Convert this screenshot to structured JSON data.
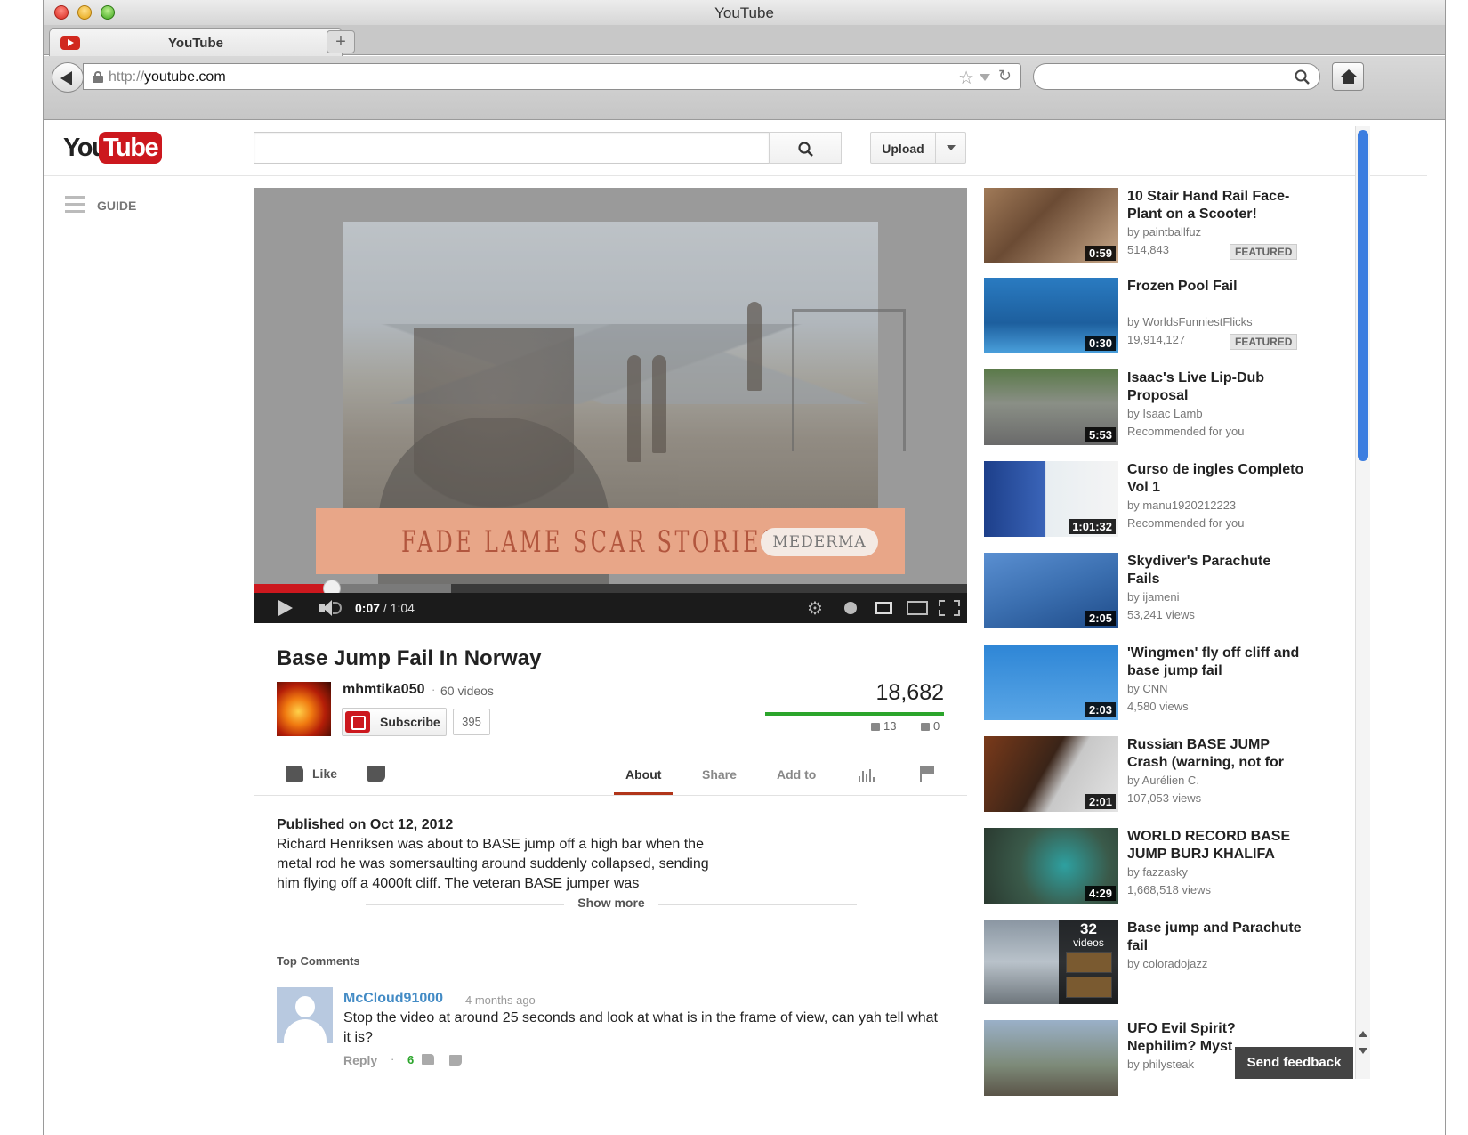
{
  "browser": {
    "window_title": "YouTube",
    "tab_title": "YouTube",
    "new_tab": "+",
    "url_protocol": "http://",
    "url_host": "youtube.com"
  },
  "masthead": {
    "logo_you": "You",
    "logo_tube": "Tube",
    "search_placeholder": "",
    "upload_label": "Upload",
    "guide_label": "GUIDE"
  },
  "player": {
    "current_time": "0:07",
    "duration": "1:04",
    "time_sep": " / ",
    "progress_fraction": 0.11,
    "buffered_fraction": 0.277,
    "ad_text": "FADE LAME SCAR STORIES.",
    "ad_brand": "MEDERMA"
  },
  "video": {
    "title": "Base Jump Fail In Norway",
    "channel": "mhmtika050",
    "channel_sep": "·",
    "channel_videos": "60 videos",
    "subscribe_label": "Subscribe",
    "subscriber_count": "395",
    "views": "18,682",
    "likes": "13",
    "dislikes": "0",
    "like_label": "Like",
    "tabs": [
      "About",
      "Share",
      "Add to"
    ],
    "published": "Published on Oct 12, 2012",
    "description": "Richard Henriksen was about to BASE jump off a high bar when the metal rod he was somersaulting around suddenly collapsed, sending him flying off a 4000ft cliff. The veteran BASE jumper was",
    "show_more": "Show more"
  },
  "comments": {
    "heading": "Top Comments",
    "items": [
      {
        "author": "McCloud91000",
        "time": "4 months ago",
        "text": "Stop the video at around 25 seconds and look at what is in the frame of view, can yah tell what it is?",
        "reply": "Reply",
        "dot": "·",
        "likes": "6"
      }
    ]
  },
  "related": [
    {
      "title": "10 Stair Hand Rail Face-Plant on a Scooter!",
      "by": "by paintballfuz",
      "meta": "514,843",
      "badge": "FEATURED",
      "duration": "0:59"
    },
    {
      "title": "Frozen Pool Fail",
      "by": "by WorldsFunniestFlicks",
      "meta": "19,914,127",
      "badge": "FEATURED",
      "duration": "0:30"
    },
    {
      "title": "Isaac's Live Lip-Dub Proposal",
      "by": "by Isaac Lamb",
      "meta": "Recommended for you",
      "badge": "",
      "duration": "5:53"
    },
    {
      "title": "Curso de ingles Completo Vol 1",
      "by": "by manu1920212223",
      "meta": "Recommended for you",
      "badge": "",
      "duration": "1:01:32"
    },
    {
      "title": "Skydiver's Parachute Fails",
      "by": "by ijameni",
      "meta": "53,241 views",
      "badge": "",
      "duration": "2:05"
    },
    {
      "title": "'Wingmen' fly off cliff and base jump fail",
      "by": "by CNN",
      "meta": "4,580 views",
      "badge": "",
      "duration": "2:03"
    },
    {
      "title": "Russian BASE JUMP Crash (warning, not for",
      "by": "by Aurélien C.",
      "meta": "107,053 views",
      "badge": "",
      "duration": "2:01"
    },
    {
      "title": "WORLD RECORD BASE JUMP BURJ KHALIFA",
      "by": "by fazzasky",
      "meta": "1,668,518 views",
      "badge": "",
      "duration": "4:29"
    },
    {
      "title": "Base jump and Parachute fail",
      "by": "by coloradojazz",
      "meta": "",
      "badge": "",
      "duration": ""
    },
    {
      "title": "UFO Evil Spirit? Nephilim? Myst",
      "by": "by philysteak",
      "meta": "",
      "badge": "",
      "duration": ""
    }
  ],
  "playlist": {
    "count": "32",
    "label": "videos"
  },
  "feedback": "Send feedback",
  "colors": {
    "brand_red": "#cc181e",
    "like_green": "#2ba52b",
    "link_blue": "#438bc5",
    "scroll_blue": "#3b7de0"
  }
}
